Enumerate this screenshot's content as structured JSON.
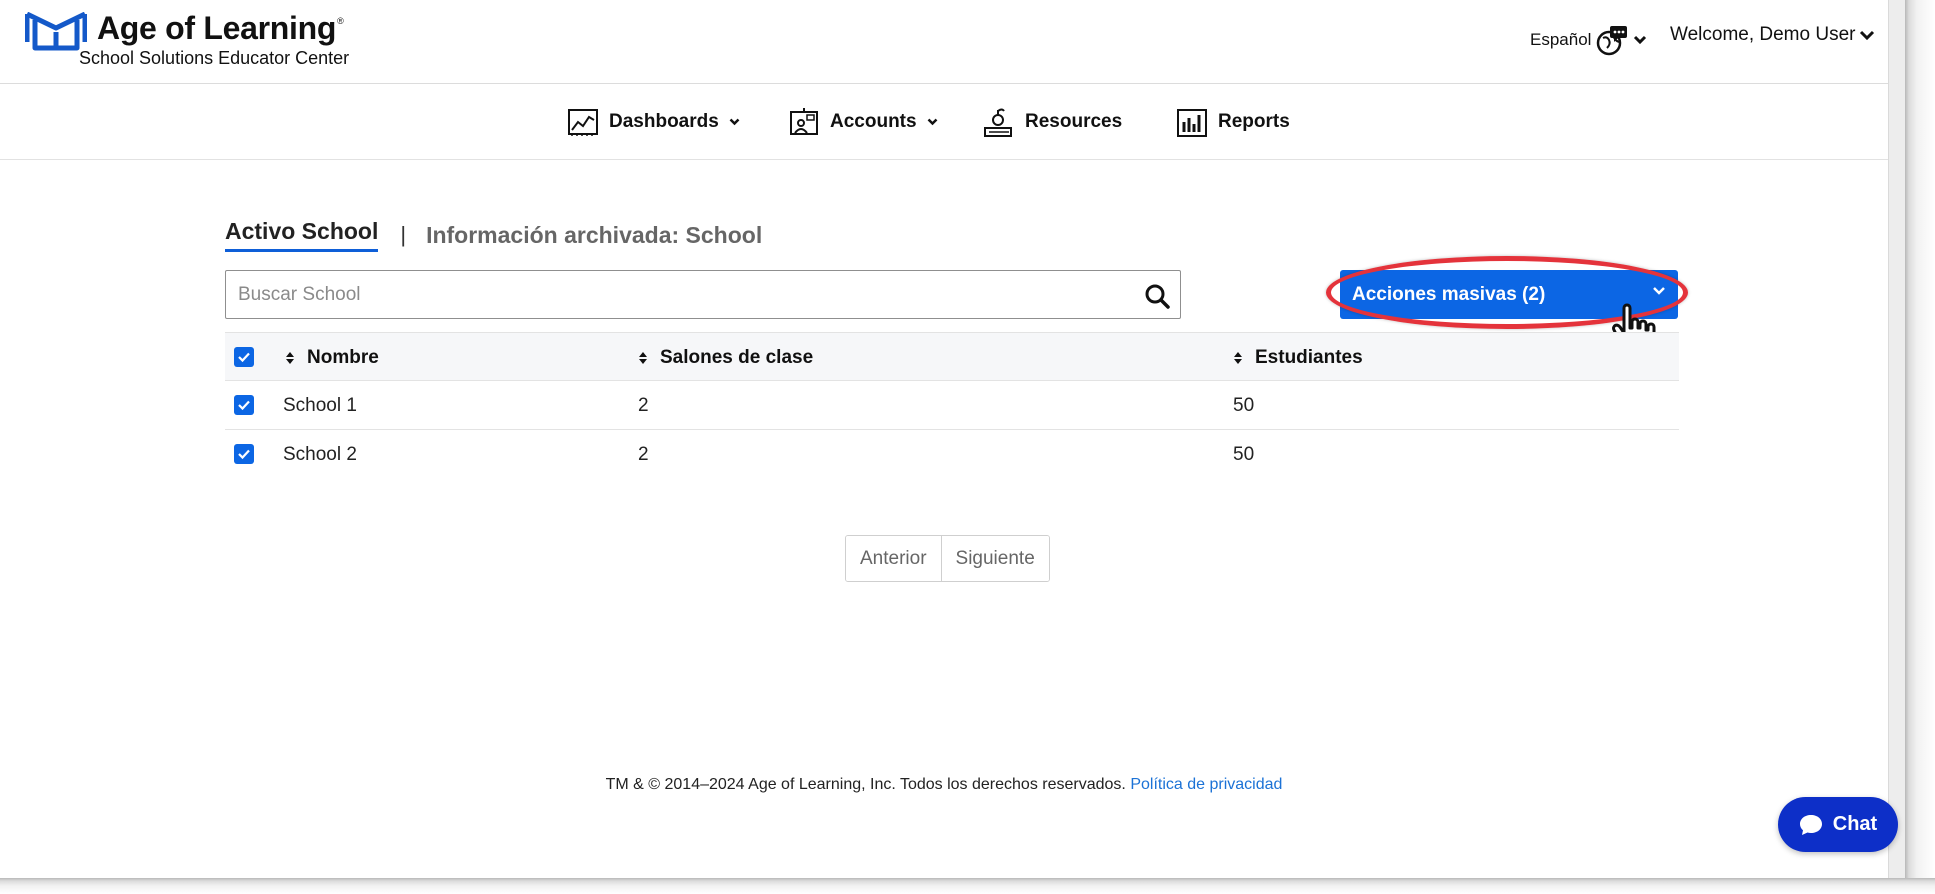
{
  "header": {
    "brand_title": "Age of Learning",
    "brand_mark": "®",
    "brand_subtitle": "School Solutions Educator Center",
    "language_label": "Español",
    "welcome_label": "Welcome, Demo User"
  },
  "nav": {
    "items": [
      {
        "label": "Dashboards",
        "icon": "line-chart-icon",
        "has_dropdown": true
      },
      {
        "label": "Accounts",
        "icon": "classroom-board-icon",
        "has_dropdown": true
      },
      {
        "label": "Resources",
        "icon": "book-apple-icon",
        "has_dropdown": false
      },
      {
        "label": "Reports",
        "icon": "bar-chart-icon",
        "has_dropdown": false
      }
    ]
  },
  "tabs": {
    "active": "Activo School",
    "separator": "|",
    "archived": "Información archivada: School"
  },
  "search": {
    "placeholder": "Buscar School",
    "value": ""
  },
  "bulk_actions": {
    "label": "Acciones masivas (2)"
  },
  "table": {
    "columns": [
      "Nombre",
      "Salones de clase",
      "Estudiantes"
    ],
    "rows": [
      {
        "name": "School 1",
        "classrooms": "2",
        "students": "50",
        "checked": true
      },
      {
        "name": "School 2",
        "classrooms": "2",
        "students": "50",
        "checked": true
      }
    ],
    "select_all_checked": true
  },
  "pagination": {
    "prev": "Anterior",
    "next": "Siguiente"
  },
  "footer": {
    "copyright": "TM & © 2014–2024 Age of Learning, Inc. Todos los derechos reservados.",
    "privacy_link": "Política de privacidad"
  },
  "chat": {
    "label": "Chat"
  },
  "colors": {
    "primary_blue": "#0c66e4",
    "highlight_red": "#e4333b",
    "chat_blue": "#0d2fc8",
    "link_blue": "#1b72d6"
  }
}
